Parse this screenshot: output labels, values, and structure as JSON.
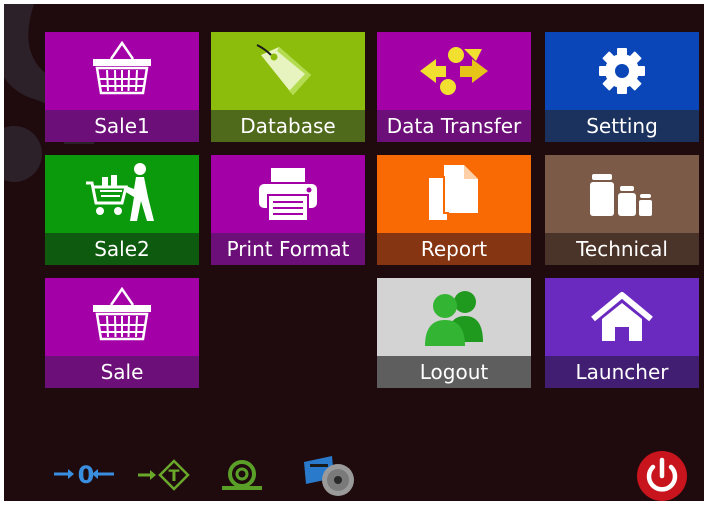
{
  "tiles": [
    {
      "name": "sale1",
      "label": "Sale1",
      "icon": "basket-icon",
      "bg": "#a300a8",
      "bar": "#6d0f78"
    },
    {
      "name": "database",
      "label": "Database",
      "icon": "tag-icon",
      "bg": "#8dbd0c",
      "bar": "#506a1c"
    },
    {
      "name": "data-transfer",
      "label": "Data Transfer",
      "icon": "transfer-arrows-icon",
      "bg": "#a300a8",
      "bar": "#6d0f78"
    },
    {
      "name": "setting",
      "label": "Setting",
      "icon": "gear-icon",
      "bg": "#0a46b8",
      "bar": "#1c325e"
    },
    {
      "name": "sale2",
      "label": "Sale2",
      "icon": "cart-person-icon",
      "bg": "#0b9a0b",
      "bar": "#0e5a0e"
    },
    {
      "name": "print-format",
      "label": "Print Format",
      "icon": "printer-icon",
      "bg": "#a300a8",
      "bar": "#6d0f78"
    },
    {
      "name": "report",
      "label": "Report",
      "icon": "documents-icon",
      "bg": "#fa6a04",
      "bar": "#863512"
    },
    {
      "name": "technical",
      "label": "Technical",
      "icon": "weights-icon",
      "bg": "#7b5a47",
      "bar": "#4a3328"
    },
    {
      "name": "sale",
      "label": "Sale",
      "icon": "basket-icon",
      "bg": "#a300a8",
      "bar": "#6d0f78"
    },
    {
      "name": "logout",
      "label": "Logout",
      "icon": "users-icon",
      "bg": "#d3d3d3",
      "bar": "#5e5e5e"
    },
    {
      "name": "launcher",
      "label": "Launcher",
      "icon": "home-icon",
      "bg": "#6a2ac0",
      "bar": "#411e72"
    }
  ],
  "status_bar": {
    "zero_label": "→0←",
    "tare_label": "T",
    "icons": [
      "zero-icon",
      "tare-icon",
      "paper-roll-icon",
      "printer-roll-icon",
      "power-icon"
    ],
    "power_color": "#c8141c"
  }
}
